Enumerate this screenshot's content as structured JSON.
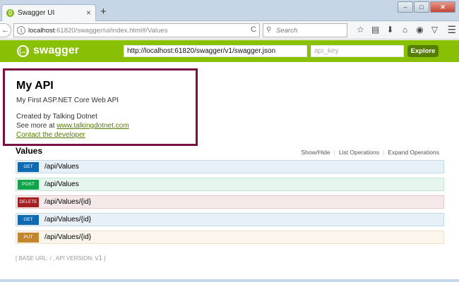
{
  "browser": {
    "tab_title": "Swagger UI",
    "tab_close": "×",
    "new_tab": "+",
    "win_minimize": "–",
    "win_maximize": "□",
    "win_close": "✕",
    "back": "←",
    "url_host": "localhost",
    "url_rest": ":61820/swagger/ui/index.html#/Values",
    "reload": "C",
    "search_placeholder": "Search",
    "toolbar_icons": [
      "star-icon",
      "bookmarks-icon",
      "download-icon",
      "home-icon",
      "chat-icon",
      "pocket-icon",
      "menu-icon"
    ]
  },
  "swagger": {
    "brand": "swagger",
    "logo_glyph": "{…}",
    "spec_url": "http://localhost:61820/swagger/v1/swagger.json",
    "api_key_placeholder": "api_key",
    "explore_label": "Explore",
    "header_color": "#89bf04"
  },
  "info": {
    "title": "My API",
    "description": "My First ASP.NET Core Web API",
    "created_by": "Created by Talking Dotnet",
    "see_more_prefix": "See more at ",
    "see_more_link": "www.talkingdotnet.com",
    "contact_link": "Contact the developer",
    "highlight_color": "#7b1043"
  },
  "resource": {
    "name": "Values",
    "show_hide": "Show/Hide",
    "list_operations": "List Operations",
    "expand_operations": "Expand Operations",
    "separator": "|",
    "operations": [
      {
        "method": "GET",
        "path": "/api/Values"
      },
      {
        "method": "POST",
        "path": "/api/Values"
      },
      {
        "method": "DELETE",
        "path": "/api/Values/{id}"
      },
      {
        "method": "GET",
        "path": "/api/Values/{id}"
      },
      {
        "method": "PUT",
        "path": "/api/Values/{id}"
      }
    ]
  },
  "footer": {
    "open": "[ ",
    "base_url_label": "BASE URL: / , API VERSION: ",
    "version": "v1",
    "close": " ]"
  }
}
